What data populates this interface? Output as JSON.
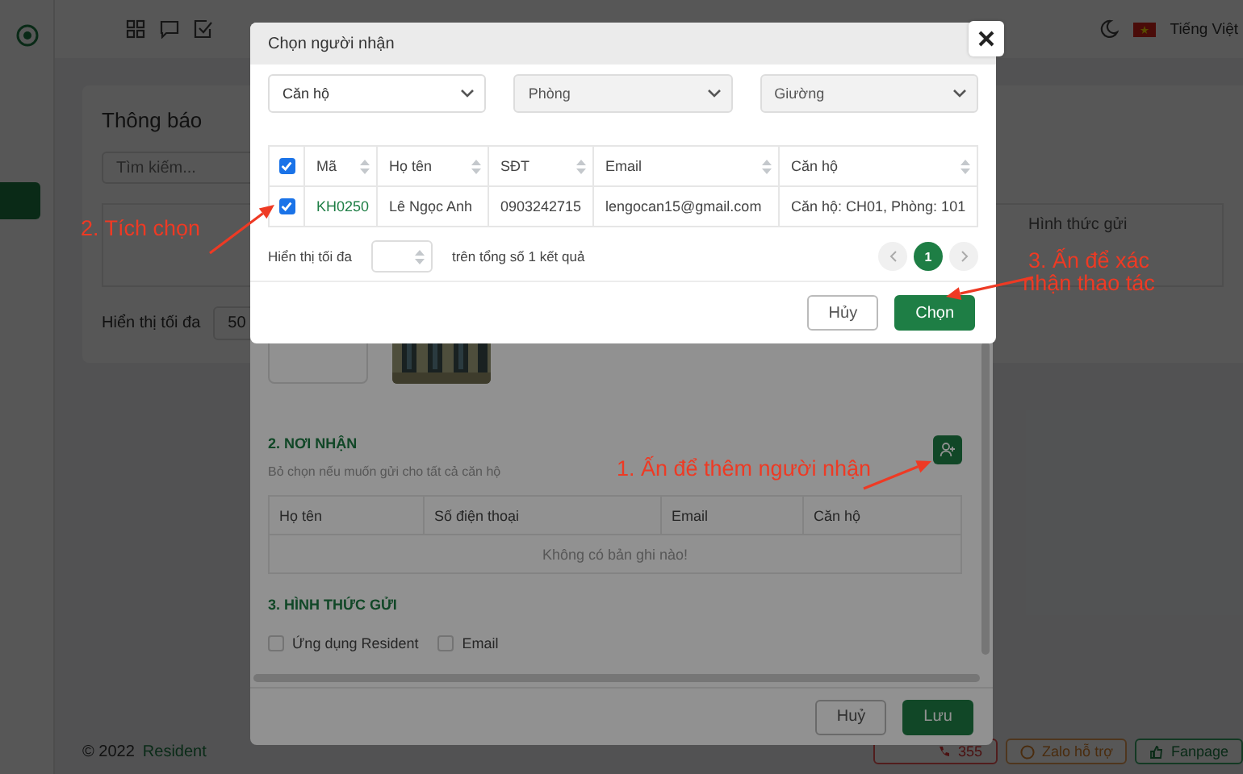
{
  "header": {
    "language": "Tiếng Việt"
  },
  "page": {
    "title": "Thông báo",
    "search": {
      "placeholder": "Tìm kiếm..."
    },
    "table": {
      "columns": [
        "Hình thức gửi"
      ]
    },
    "page_size": {
      "label": "Hiển thị tối đa",
      "value": "50"
    }
  },
  "footer": {
    "copyright": "© 2022",
    "brand": "Resident",
    "buttons": [
      {
        "kind": "phone",
        "label": "355"
      },
      {
        "kind": "zalo",
        "label": "Zalo hỗ trợ"
      },
      {
        "kind": "fanpage",
        "label": "Fanpage"
      }
    ]
  },
  "form_dialog": {
    "sections": [
      {
        "title": "2. NƠI NHẬN",
        "hint": "Bỏ chọn nếu muốn gửi cho tất cả căn hộ"
      },
      {
        "title": "3. HÌNH THỨC GỬI"
      }
    ],
    "table": {
      "columns": [
        "Họ tên",
        "Số điện thoại",
        "Email",
        "Căn hộ"
      ],
      "empty_text": "Không có bản ghi nào!"
    },
    "channels": [
      {
        "label": "Ứng dụng Resident",
        "checked": false
      },
      {
        "label": "Email",
        "checked": false
      }
    ],
    "buttons": [
      {
        "kind": "secondary",
        "label": "Huỷ"
      },
      {
        "kind": "primary",
        "label": "Lưu"
      }
    ]
  },
  "picker_dialog": {
    "title": "Chọn người nhận",
    "filters": [
      {
        "label": "Căn hộ",
        "disabled": false
      },
      {
        "label": "Phòng",
        "disabled": true
      },
      {
        "label": "Giường",
        "disabled": true
      }
    ],
    "table": {
      "all_checked": true,
      "columns": [
        "Mã",
        "Họ tên",
        "SĐT",
        "Email",
        "Căn hộ"
      ],
      "rows": [
        {
          "checked": true,
          "cells": [
            "KH0250",
            "Lê Ngọc Anh",
            "0903242715",
            "lengocan15@gmail.com",
            "Căn hộ: CH01, Phòng: 101"
          ]
        }
      ]
    },
    "page_size_label": "Hiển thị tối đa",
    "summary": "trên tổng số 1 kết quả",
    "pages": [
      {
        "label": "1",
        "selected": true
      }
    ],
    "buttons": [
      {
        "kind": "secondary",
        "label": "Hủy"
      },
      {
        "kind": "primary",
        "label": "Chọn"
      }
    ]
  },
  "annotations": [
    {
      "text": "2. Tích chọn"
    },
    {
      "text": "3. Ấn để xác nhận thao tác"
    },
    {
      "text": "1. Ấn để thêm người nhận"
    }
  ]
}
